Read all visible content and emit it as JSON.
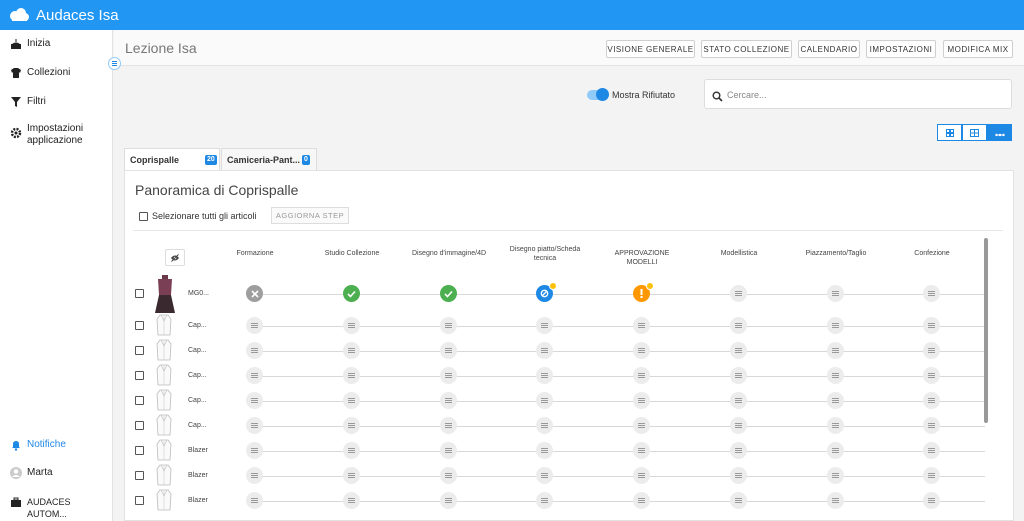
{
  "app": {
    "title": "Audaces Isa"
  },
  "sidebar": {
    "items": [
      {
        "label": "Inizia",
        "icon": "cake-icon"
      },
      {
        "label": "Collezioni",
        "icon": "shirt-icon"
      },
      {
        "label": "Filtri",
        "icon": "filter-icon"
      },
      {
        "label": "Impostazioni applicazione",
        "icon": "gear-icon"
      }
    ],
    "bottom": [
      {
        "label": "Notifiche",
        "icon": "bell-icon"
      },
      {
        "label": "Marta",
        "icon": "avatar-icon"
      },
      {
        "label": "AUDACES AUTOM...",
        "icon": "briefcase-icon"
      }
    ]
  },
  "header": {
    "title": "Lezione Isa",
    "buttons": [
      "VISIONE GENERALE",
      "STATO COLLEZIONE",
      "CALENDARIO",
      "IMPOSTAZIONI",
      "MODIFICA MIX"
    ]
  },
  "toolbar": {
    "toggle_label": "Mostra Rifiutato",
    "search_placeholder": "Cercare..."
  },
  "tabs": [
    {
      "label": "Coprispalle",
      "count": "20"
    },
    {
      "label": "Camiceria-Pant...",
      "count": "0"
    }
  ],
  "panel": {
    "title": "Panoramica di Coprispalle",
    "select_all": "Selezionare tutti gli articoli",
    "update_button": "AGGIORNA STEP",
    "columns": [
      "Formazione",
      "Studio Collezione",
      "Disegno d'immagine/4D",
      "Disegno piatto/Scheda tecnica",
      "APPROVAZIONE MODELLI",
      "Modellistica",
      "Piazzamento/Taglio",
      "Confezione"
    ],
    "rows": [
      {
        "label": "MG0...",
        "statuses": [
          "rejected",
          "done",
          "done",
          "in-progress",
          "warning",
          "pending",
          "pending",
          "pending"
        ]
      },
      {
        "label": "Cap...",
        "statuses": [
          "pending",
          "pending",
          "pending",
          "pending",
          "pending",
          "pending",
          "pending",
          "pending"
        ]
      },
      {
        "label": "Cap...",
        "statuses": [
          "pending",
          "pending",
          "pending",
          "pending",
          "pending",
          "pending",
          "pending",
          "pending"
        ]
      },
      {
        "label": "Cap...",
        "statuses": [
          "pending",
          "pending",
          "pending",
          "pending",
          "pending",
          "pending",
          "pending",
          "pending"
        ]
      },
      {
        "label": "Cap...",
        "statuses": [
          "pending",
          "pending",
          "pending",
          "pending",
          "pending",
          "pending",
          "pending",
          "pending"
        ]
      },
      {
        "label": "Cap...",
        "statuses": [
          "pending",
          "pending",
          "pending",
          "pending",
          "pending",
          "pending",
          "pending",
          "pending"
        ]
      },
      {
        "label": "Blazer",
        "statuses": [
          "pending",
          "pending",
          "pending",
          "pending",
          "pending",
          "pending",
          "pending",
          "pending"
        ]
      },
      {
        "label": "Blazer",
        "statuses": [
          "pending",
          "pending",
          "pending",
          "pending",
          "pending",
          "pending",
          "pending",
          "pending"
        ]
      },
      {
        "label": "Blazer",
        "statuses": [
          "pending",
          "pending",
          "pending",
          "pending",
          "pending",
          "pending",
          "pending",
          "pending"
        ]
      }
    ]
  },
  "colors": {
    "accent": "#2196f3",
    "done": "#4caf50",
    "rejected": "#9e9e9e",
    "warning": "#ff9800",
    "progress": "#1e88e5"
  }
}
